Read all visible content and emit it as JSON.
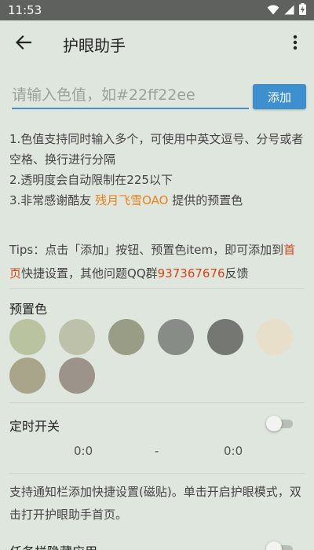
{
  "status_bar": {
    "time": "11:53"
  },
  "app_bar": {
    "title": "护眼助手"
  },
  "input": {
    "placeholder": "请输入色值，如#22ff22ee",
    "add_label": "添加"
  },
  "notes": [
    "1.色值支持同时输入多个，可使用中英文逗号、分号或者空格、换行进行分隔",
    "2.透明度会自动限制在225以下",
    {
      "before": "3.非常感谢酷友 ",
      "highlight": "残月飞雪OAO",
      "after": " 提供的预置色"
    }
  ],
  "tips": {
    "part1": "Tips：点击「添加」按钮、预置色item，即可添加到",
    "link": "首页",
    "part2": "快捷设置，其他问题QQ群",
    "qq": "937367676",
    "part3": "反馈"
  },
  "presets": {
    "title": "预置色",
    "colors": [
      "#b9c3a0",
      "#bec1aa",
      "#999d86",
      "#888c87",
      "#757872",
      "#e7dfca",
      "#a8a58a",
      "#9c948a"
    ]
  },
  "timer": {
    "title": "定时开关",
    "enabled": false,
    "start": "0:0",
    "separator": "-",
    "end": "0:0"
  },
  "description": "支持通知栏添加快捷设置(磁贴)。单击开启护眼模式，双击打开护眼助手首页。",
  "hide_task": {
    "title": "任务栏隐藏应用",
    "enabled": false
  },
  "colors": {
    "accent": "#3d8fcd",
    "highlight_orange": "#e8821e",
    "highlight_red": "#d84315",
    "background": "#dfe6dd",
    "status_bar": "#5f615e"
  }
}
